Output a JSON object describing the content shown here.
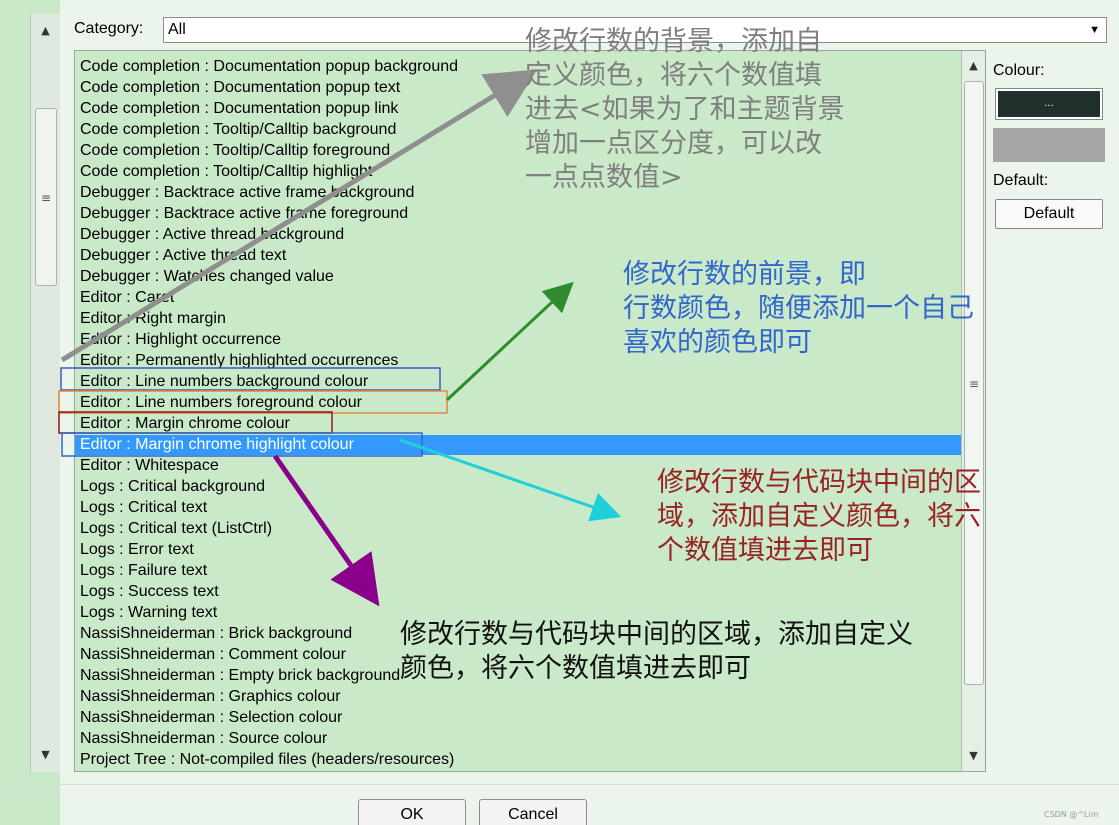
{
  "category": {
    "label": "Category:",
    "value": "All"
  },
  "items": [
    "Code completion : Documentation popup background",
    "Code completion : Documentation popup text",
    "Code completion : Documentation popup link",
    "Code completion : Tooltip/Calltip background",
    "Code completion : Tooltip/Calltip foreground",
    "Code completion : Tooltip/Calltip highlight",
    "Debugger : Backtrace active frame background",
    "Debugger : Backtrace active frame foreground",
    "Debugger : Active thread background",
    "Debugger : Active thread text",
    "Debugger : Watches changed value",
    "Editor : Caret",
    "Editor : Right margin",
    "Editor : Highlight occurrence",
    "Editor : Permanently highlighted occurrences",
    "Editor : Line numbers background colour",
    "Editor : Line numbers foreground colour",
    "Editor : Margin chrome colour",
    "Editor : Margin chrome highlight colour",
    "Editor : Whitespace",
    "Logs : Critical background",
    "Logs : Critical text",
    "Logs : Critical text (ListCtrl)",
    "Logs : Error text",
    "Logs : Failure text",
    "Logs : Success text",
    "Logs : Warning text",
    "NassiShneiderman : Brick background",
    "NassiShneiderman : Comment colour",
    "NassiShneiderman : Empty brick background",
    "NassiShneiderman : Graphics colour",
    "NassiShneiderman : Selection colour",
    "NassiShneiderman : Source colour",
    "Project Tree : Not-compiled files (headers/resources)"
  ],
  "selected_index": 18,
  "colour": {
    "label": "Colour:",
    "button_text": "...",
    "current": "#20302c",
    "preview": "#a7a7a7"
  },
  "default": {
    "label": "Default:",
    "button": "Default"
  },
  "buttons": {
    "ok": "OK",
    "cancel": "Cancel"
  },
  "annotations": {
    "bg_note": [
      "修改行数的背景，添加自",
      "定义颜色，将六个数值填",
      "进去<如果为了和主题背景",
      "增加一点区分度，可以改",
      "一点点数值>"
    ],
    "fg_note": [
      "修改行数的前景，即",
      "行数颜色，随便添加一个自己",
      "喜欢的颜色即可"
    ],
    "margin_note": [
      "修改行数与代码块中间的区",
      "域，添加自定义颜色，将六",
      "个数值填进去即可"
    ],
    "highlight_note": [
      "修改行数与代码块中间的区域，添加自定义",
      "颜色，将六个数值填进去即可"
    ]
  },
  "colors": {
    "accent": "#3399ff",
    "list_bg": "#c9e9c9",
    "gray_arrow": "#8f8f8f",
    "green_arrow": "#2e8b2e",
    "cyan_arrow": "#20d0d8",
    "purple_arrow": "#8b008b"
  },
  "watermark": "CSDN @^Lim"
}
